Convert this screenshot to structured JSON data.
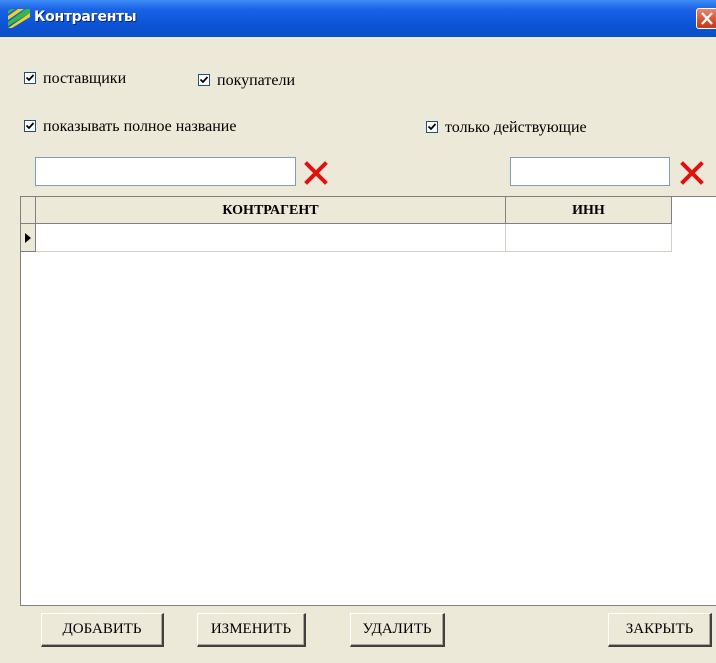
{
  "window": {
    "title": "Контрагенты"
  },
  "filters": {
    "suppliers": {
      "label": "поставщики",
      "checked": true
    },
    "buyers": {
      "label": "покупатели",
      "checked": true
    },
    "full_name": {
      "label": "показывать полное название",
      "checked": true
    },
    "active_only": {
      "label": "только действующие",
      "checked": true
    }
  },
  "search": {
    "name_value": "",
    "inn_value": ""
  },
  "table": {
    "columns": [
      "КОНТРАГЕНТ",
      "ИНН"
    ],
    "rows": [
      [
        "",
        ""
      ]
    ]
  },
  "buttons": {
    "add": "ДОБАВИТЬ",
    "edit": "ИЗМЕНИТЬ",
    "delete": "УДАЛИТЬ",
    "close": "ЗАКРЫТЬ"
  },
  "icons": {
    "app": "stripes-app-icon",
    "clear": "red-x-icon",
    "row_pointer": "triangle-right-icon"
  },
  "colors": {
    "title_bar": "#0d55d9",
    "clear_x": "#e01010",
    "close_button": "#d3502f"
  }
}
